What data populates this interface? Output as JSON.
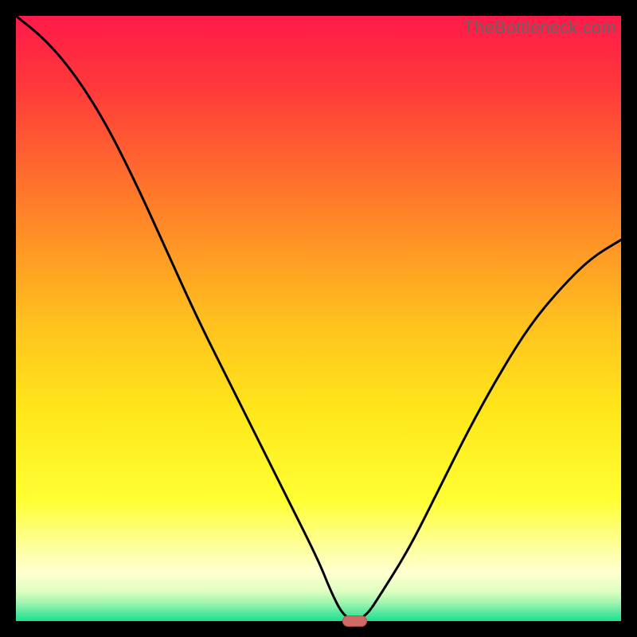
{
  "watermark": "TheBottleneck.com",
  "colors": {
    "frame": "#000000",
    "curve": "#000000",
    "marker_fill": "#cf6a66",
    "marker_stroke": "#b75650",
    "gradient_stops": [
      {
        "offset": 0.0,
        "color": "#ff1a4a"
      },
      {
        "offset": 0.12,
        "color": "#ff3a3a"
      },
      {
        "offset": 0.3,
        "color": "#ff7a2a"
      },
      {
        "offset": 0.5,
        "color": "#ffbf1f"
      },
      {
        "offset": 0.65,
        "color": "#ffe61a"
      },
      {
        "offset": 0.8,
        "color": "#ffff33"
      },
      {
        "offset": 0.88,
        "color": "#ffffa0"
      },
      {
        "offset": 0.92,
        "color": "#ffffd0"
      },
      {
        "offset": 0.95,
        "color": "#e0ffc0"
      },
      {
        "offset": 0.97,
        "color": "#a0f5b0"
      },
      {
        "offset": 0.985,
        "color": "#5ce8a0"
      },
      {
        "offset": 1.0,
        "color": "#19e28e"
      }
    ]
  },
  "chart_data": {
    "type": "line",
    "title": "",
    "xlabel": "",
    "ylabel": "",
    "xlim": [
      0,
      100
    ],
    "ylim": [
      0,
      100
    ],
    "x": [
      0,
      5,
      10,
      15,
      20,
      25,
      30,
      35,
      40,
      45,
      50,
      52,
      54,
      56,
      58,
      60,
      65,
      70,
      75,
      80,
      85,
      90,
      95,
      100
    ],
    "values": [
      100,
      96,
      90,
      82,
      72,
      61,
      50,
      40,
      30,
      20,
      10,
      5,
      1,
      0,
      1,
      4,
      12,
      22,
      32,
      41,
      49,
      55,
      60,
      63
    ],
    "marker": {
      "x_range": [
        54,
        58
      ],
      "y": 0
    },
    "notes": "Bottleneck/V-curve style chart with valley near x≈56 at y=0; left branch starts at top-left corner (0,100), right branch ends near y≈63 at x=100."
  }
}
